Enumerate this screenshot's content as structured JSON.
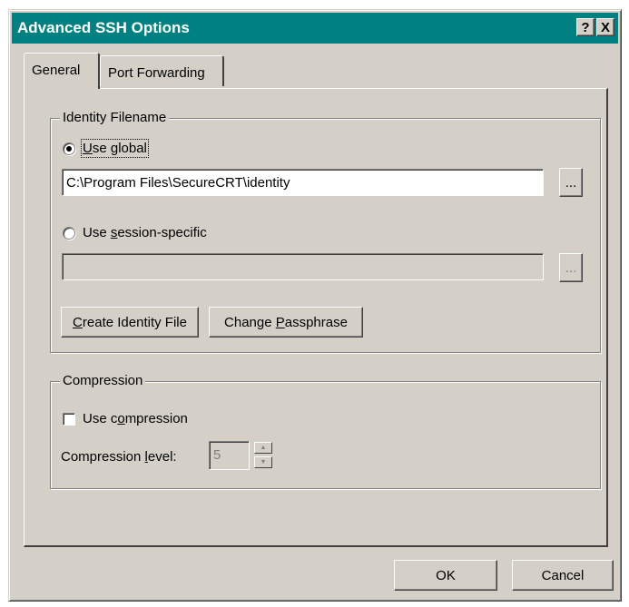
{
  "window": {
    "title": "Advanced SSH Options",
    "help_button": "?",
    "close_button": "X"
  },
  "tabs": [
    {
      "label": "General",
      "active": true
    },
    {
      "label": "Port Forwarding",
      "active": false
    }
  ],
  "identity_group": {
    "legend": "Identity Filename",
    "use_global": {
      "pre": "",
      "ul": "U",
      "post": "se global",
      "selected": true
    },
    "global_path": "C:\\Program Files\\SecureCRT\\identity",
    "browse_label": "...",
    "use_session": {
      "pre": "Use ",
      "ul": "s",
      "post": "ession-specific",
      "selected": false
    },
    "session_path": "",
    "create_button": {
      "pre": "",
      "ul": "C",
      "post": "reate Identity File"
    },
    "change_button": {
      "pre": "Change ",
      "ul": "P",
      "post": "assphrase"
    }
  },
  "compression_group": {
    "legend": "Compression",
    "use_compression": {
      "pre": "Use c",
      "ul": "o",
      "post": "mpression",
      "checked": false
    },
    "level_label": {
      "pre": "Compression ",
      "ul": "l",
      "post": "evel:"
    },
    "level_value": "5"
  },
  "footer": {
    "ok": "OK",
    "cancel": "Cancel"
  }
}
